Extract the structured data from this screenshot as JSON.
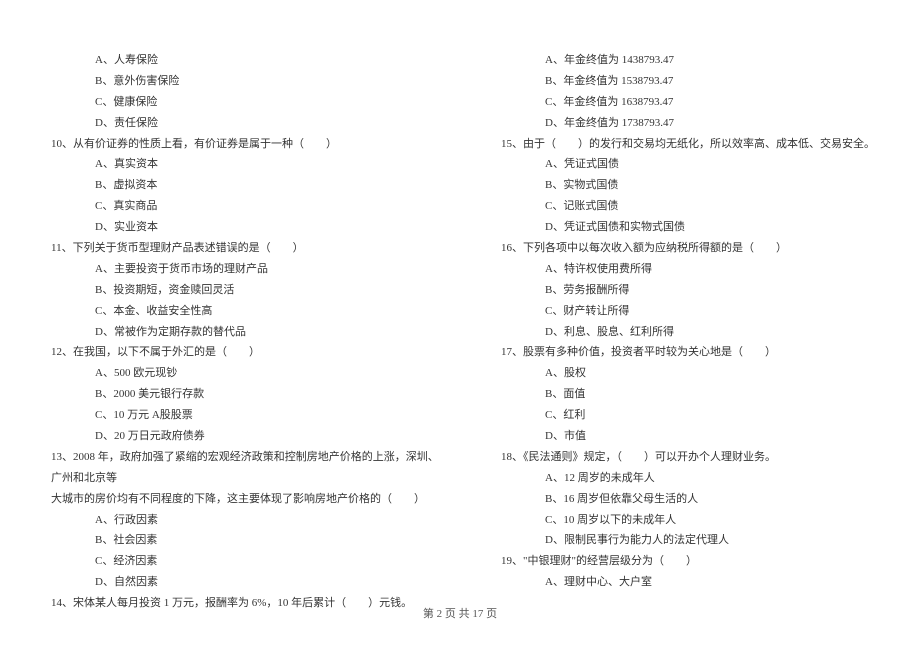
{
  "left_column": {
    "opts_a": {
      "a": "A、人寿保险",
      "b": "B、意外伤害保险",
      "c": "C、健康保险",
      "d": "D、责任保险"
    },
    "q10": "10、从有价证券的性质上看，有价证券是属于一种（　　）",
    "q10_opts": {
      "a": "A、真实资本",
      "b": "B、虚拟资本",
      "c": "C、真实商品",
      "d": "D、实业资本"
    },
    "q11": "11、下列关于货币型理财产品表述错误的是（　　）",
    "q11_opts": {
      "a": "A、主要投资于货币市场的理财产品",
      "b": "B、投资期短，资金赎回灵活",
      "c": "C、本金、收益安全性高",
      "d": "D、常被作为定期存款的替代品"
    },
    "q12": "12、在我国，以下不属于外汇的是（　　）",
    "q12_opts": {
      "a": "A、500 欧元现钞",
      "b": "B、2000 美元银行存款",
      "c": "C、10 万元 A股股票",
      "d": "D、20 万日元政府债券"
    },
    "q13_line1": "13、2008 年，政府加强了紧缩的宏观经济政策和控制房地产价格的上涨，深圳、广州和北京等",
    "q13_line2": "大城市的房价均有不同程度的下降，这主要体现了影响房地产价格的（　　）",
    "q13_opts": {
      "a": "A、行政因素",
      "b": "B、社会因素",
      "c": "C、经济因素",
      "d": "D、自然因素"
    },
    "q14": "14、宋体某人每月投资 1 万元，报酬率为 6%，10 年后累计（　　）元钱。"
  },
  "right_column": {
    "q14_opts": {
      "a": "A、年金终值为 1438793.47",
      "b": "B、年金终值为 1538793.47",
      "c": "C、年金终值为 1638793.47",
      "d": "D、年金终值为 1738793.47"
    },
    "q15": "15、由于（　　）的发行和交易均无纸化，所以效率高、成本低、交易安全。",
    "q15_opts": {
      "a": "A、凭证式国债",
      "b": "B、实物式国债",
      "c": "C、记账式国债",
      "d": "D、凭证式国债和实物式国债"
    },
    "q16": "16、下列各项中以每次收入额为应纳税所得额的是（　　）",
    "q16_opts": {
      "a": "A、特许权使用费所得",
      "b": "B、劳务报酬所得",
      "c": "C、财产转让所得",
      "d": "D、利息、股息、红利所得"
    },
    "q17": "17、股票有多种价值，投资者平时较为关心地是（　　）",
    "q17_opts": {
      "a": "A、股权",
      "b": "B、面值",
      "c": "C、红利",
      "d": "D、市值"
    },
    "q18": "18、《民法通则》规定，（　　）可以开办个人理财业务。",
    "q18_opts": {
      "a": "A、12 周岁的未成年人",
      "b": "B、16 周岁但依靠父母生活的人",
      "c": "C、10 周岁以下的未成年人",
      "d": "D、限制民事行为能力人的法定代理人"
    },
    "q19": "19、\"中银理财\"的经营层级分为（　　）",
    "q19_opts": {
      "a": "A、理财中心、大户室"
    }
  },
  "footer": "第 2 页 共 17 页"
}
